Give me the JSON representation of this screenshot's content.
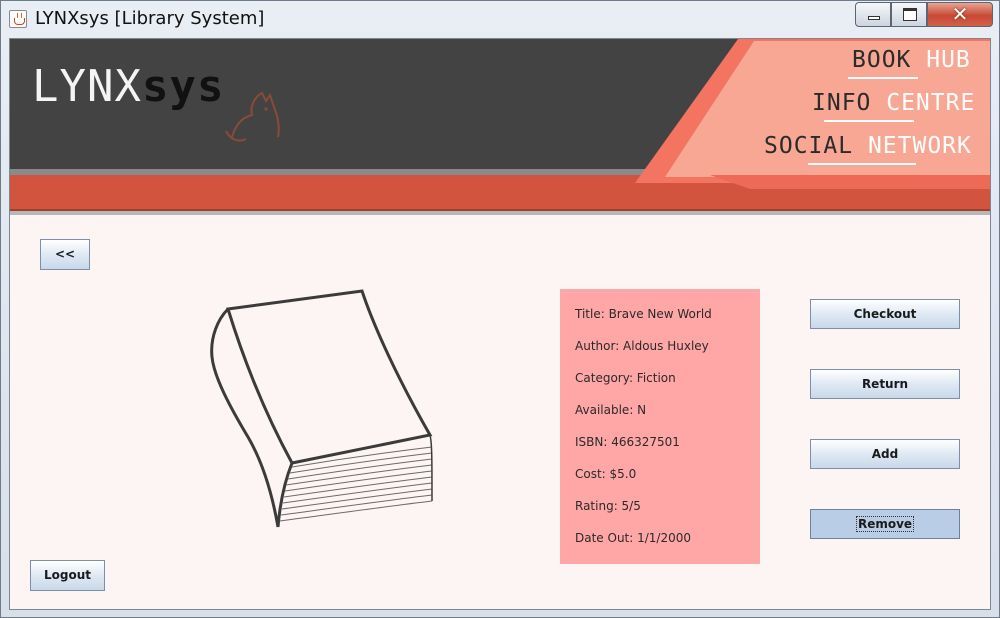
{
  "window": {
    "title": "LYNXsys [Library System]",
    "controls": {
      "minimize": "minimize",
      "maximize": "maximize",
      "close": "✕"
    }
  },
  "banner": {
    "logo_part1": "LYNX",
    "logo_part2": "sys",
    "nav": [
      {
        "part1": "BOOK",
        "part2": " HUB"
      },
      {
        "part1": "INFO",
        "part2": " CENTRE"
      },
      {
        "part1": "SOCIAL",
        "part2": " NETWORK"
      }
    ],
    "colors": {
      "dark": "#434343",
      "accent": "#d2543e",
      "salmon": "#f7a793"
    }
  },
  "buttons": {
    "back": "<<",
    "logout": "Logout",
    "checkout": "Checkout",
    "return": "Return",
    "add": "Add",
    "remove": "Remove"
  },
  "book_info": {
    "title": "Title: Brave New World",
    "author": "Author: Aldous Huxley",
    "category": "Category: Fiction",
    "available": "Available: N",
    "isbn": "ISBN: 466327501",
    "cost": "Cost: $5.0",
    "rating": "Rating: 5/5",
    "date_out": "Date Out: 1/1/2000"
  },
  "icons": [
    "java-cup-icon",
    "book-illustration",
    "cat-logo-icon"
  ]
}
